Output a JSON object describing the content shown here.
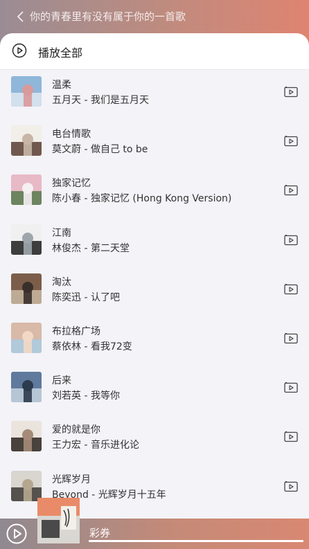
{
  "header": {
    "title": "你的青春里有没有属于你的一首歌"
  },
  "play_all": {
    "label": "播放全部"
  },
  "songs": [
    {
      "title": "温柔",
      "artist_album": "五月天 - 我们是五月天",
      "cover_colors": [
        "#8fb7d9",
        "#dfe7f0",
        "#d99a9a"
      ]
    },
    {
      "title": "电台情歌",
      "artist_album": "莫文蔚 - 做自己 to be",
      "cover_colors": [
        "#f2efe9",
        "#5a3d33",
        "#c7b6a8"
      ]
    },
    {
      "title": "独家记忆",
      "artist_album": "陈小春 - 独家记忆 (Hong Kong Version)",
      "cover_colors": [
        "#e8b9c6",
        "#567a4c",
        "#f5f0f2"
      ]
    },
    {
      "title": "江南",
      "artist_album": "林俊杰 - 第二天堂",
      "cover_colors": [
        "#f0f0f0",
        "#1d1d1d",
        "#9da6ad"
      ]
    },
    {
      "title": "淘汰",
      "artist_album": "陈奕迅 - 认了吧",
      "cover_colors": [
        "#7b5d4a",
        "#c9b9a2",
        "#3a2f2a"
      ]
    },
    {
      "title": "布拉格广场",
      "artist_album": "蔡依林 - 看我72变",
      "cover_colors": [
        "#d9b9a7",
        "#a9cbe2",
        "#f2d8c5"
      ]
    },
    {
      "title": "后来",
      "artist_album": "刘若英 - 我等你",
      "cover_colors": [
        "#5f7a9c",
        "#c7d3df",
        "#2d3b4e"
      ]
    },
    {
      "title": "爱的就是你",
      "artist_album": "王力宏 - 音乐进化论",
      "cover_colors": [
        "#eae4dd",
        "#2c2420",
        "#a58b77"
      ]
    },
    {
      "title": "光辉岁月",
      "artist_album": "Beyond - 光辉岁月十五年",
      "cover_colors": [
        "#d9d5cf",
        "#3d3a36",
        "#b5a78f"
      ]
    }
  ],
  "player": {
    "track": "彩券",
    "progress": 1.0
  }
}
